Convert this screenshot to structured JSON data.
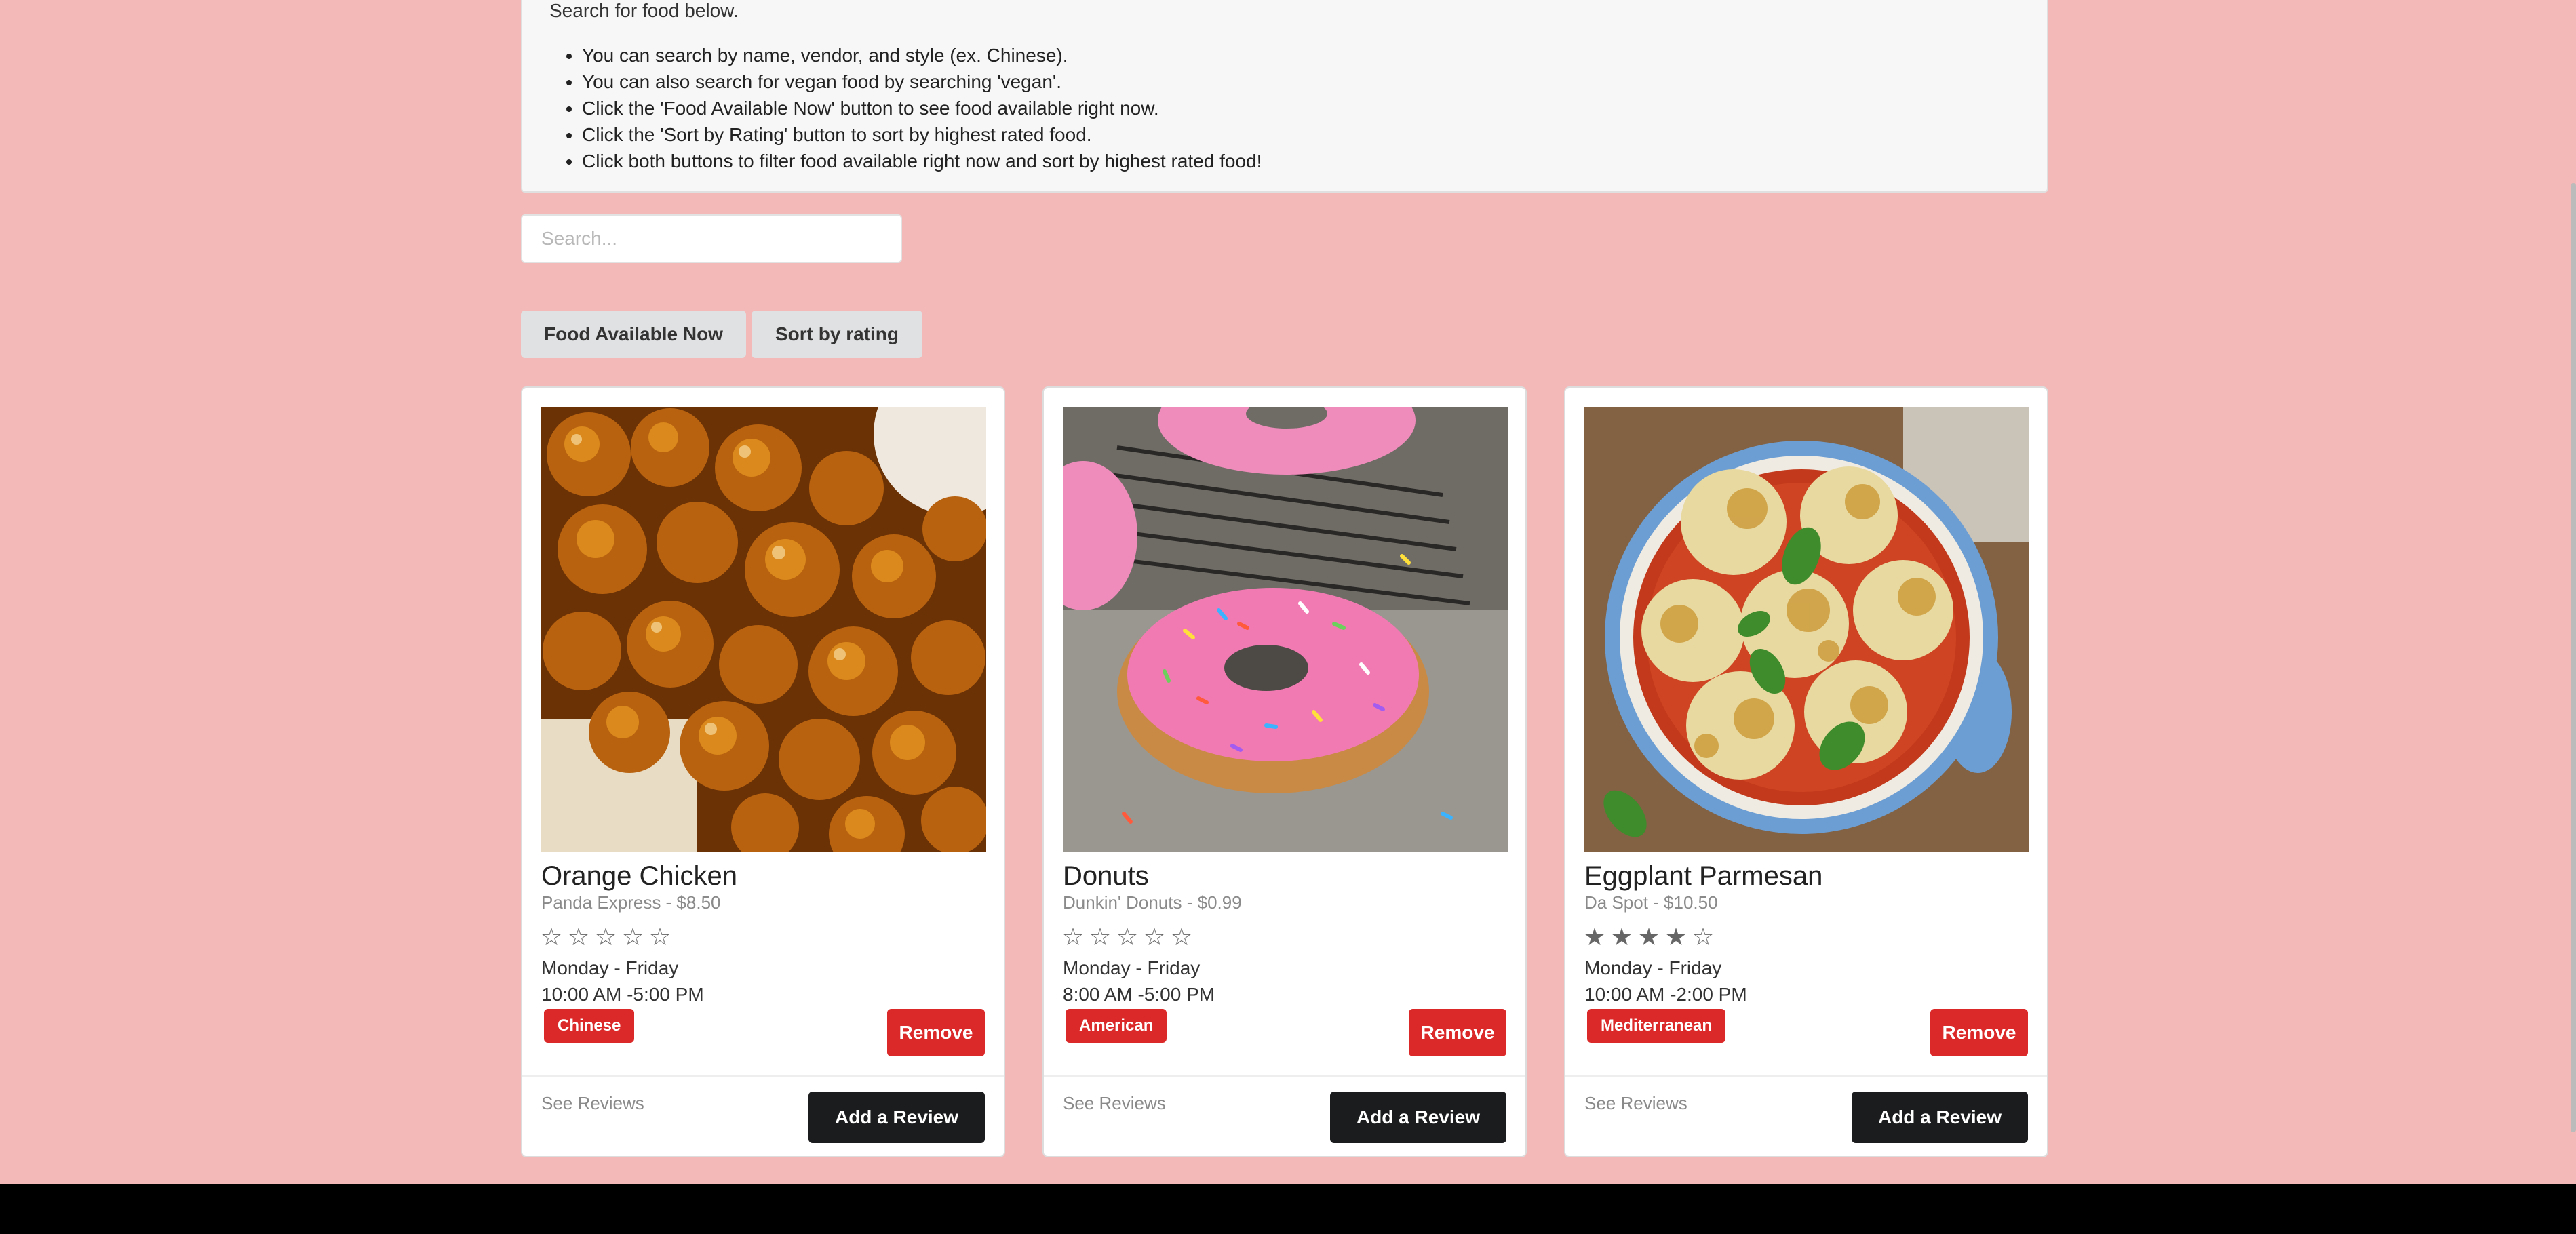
{
  "instructions": {
    "intro": "Search for food below.",
    "items": [
      "You can search by name, vendor, and style (ex. Chinese).",
      "You can also search for vegan food by searching 'vegan'.",
      "Click the 'Food Available Now' button to see food available right now.",
      "Click the 'Sort by Rating' button to sort by highest rated food.",
      "Click both buttons to filter food available right now and sort by highest rated food!"
    ]
  },
  "search": {
    "placeholder": "Search...",
    "value": ""
  },
  "filters": {
    "available_now_label": "Food Available Now",
    "sort_label": "Sort by rating"
  },
  "cards": [
    {
      "title": "Orange Chicken",
      "meta": "Panda Express - $8.50",
      "rating": 0,
      "days": "Monday - Friday",
      "hours": "10:00 AM -5:00 PM",
      "tag": "Chinese",
      "remove_label": "Remove",
      "see_reviews_label": "See Reviews",
      "add_review_label": "Add a Review"
    },
    {
      "title": "Donuts",
      "meta": "Dunkin' Donuts - $0.99",
      "rating": 0,
      "days": "Monday - Friday",
      "hours": "8:00 AM -5:00 PM",
      "tag": "American",
      "remove_label": "Remove",
      "see_reviews_label": "See Reviews",
      "add_review_label": "Add a Review"
    },
    {
      "title": "Eggplant Parmesan",
      "meta": "Da Spot - $10.50",
      "rating": 4,
      "days": "Monday - Friday",
      "hours": "10:00 AM -2:00 PM",
      "tag": "Mediterranean",
      "remove_label": "Remove",
      "see_reviews_label": "See Reviews",
      "add_review_label": "Add a Review"
    }
  ],
  "colors": {
    "page_background": "#f2b9b8",
    "danger": "#db2828",
    "dark_button": "#1b1c1d",
    "filter_button": "#e0e1e2"
  }
}
